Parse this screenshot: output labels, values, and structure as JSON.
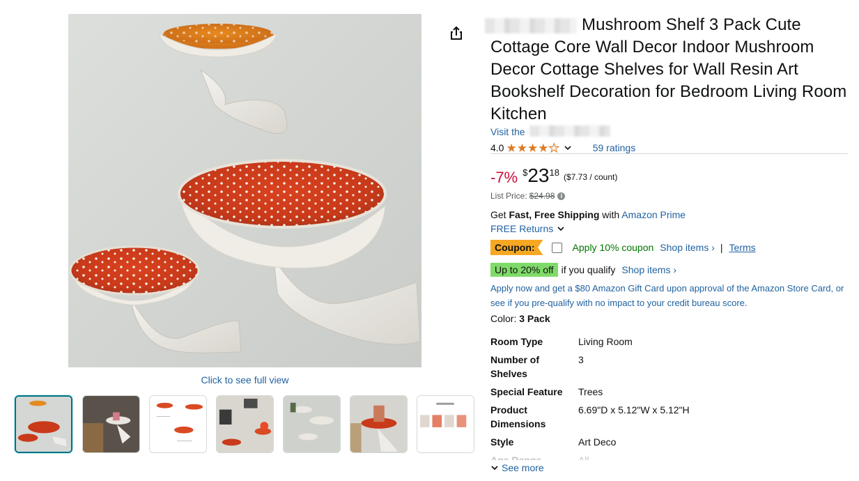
{
  "product": {
    "title": "Mushroom Shelf 3 Pack Cute Cottage Core Wall Decor Indoor Mushroom Decor Cottage Shelves for Wall Resin Art Bookshelf Decoration for Bedroom Living Room Kitchen",
    "store_link_prefix": "Visit the "
  },
  "rating": {
    "value": "4.0",
    "stars": 4,
    "count_label": "59 ratings"
  },
  "price": {
    "discount": "-7%",
    "currency": "$",
    "whole": "23",
    "fraction": "18",
    "unit_price": "($7.73 / count)",
    "list_label": "List Price:",
    "list_value": "$24.98"
  },
  "shipping": {
    "get": "Get ",
    "fast_free": "Fast, Free Shipping",
    "with": " with ",
    "prime_link": "Amazon Prime",
    "returns": "FREE Returns"
  },
  "coupon": {
    "badge": "Coupon:",
    "text": "Apply 10% coupon",
    "shop_items": "Shop items ›",
    "separator": "|",
    "terms": "Terms"
  },
  "deal": {
    "badge": "Up to 20% off",
    "qualify": "if you qualify",
    "shop_items": "Shop items ›"
  },
  "card_offer": "Apply now and get a $80 Amazon Gift Card upon approval of the Amazon Store Card, or see if you pre-qualify with no impact to your credit bureau score.",
  "color": {
    "label": "Color: ",
    "value": "3 Pack"
  },
  "specs": [
    {
      "key": "Room Type",
      "value": "Living Room"
    },
    {
      "key": "Number of Shelves",
      "value": "3"
    },
    {
      "key": "Special Feature",
      "value": "Trees"
    },
    {
      "key": "Product Dimensions",
      "value": "6.69\"D x 5.12\"W x 5.12\"H"
    },
    {
      "key": "Style",
      "value": "Art Deco"
    },
    {
      "key": "Age Range",
      "value": "All"
    }
  ],
  "see_more": "See more",
  "gallery": {
    "full_view": "Click to see full view",
    "thumbnail_count": 7,
    "selected_index": 0
  },
  "icons": {
    "share": "share-icon",
    "star": "star-icon",
    "chevron": "chevron-down-icon",
    "info": "info-icon"
  },
  "colors": {
    "link": "#2162a1",
    "star": "#de7921",
    "discount": "#cc0c39",
    "coupon_badge": "#f6a823",
    "deal_badge": "#7fda69",
    "coupon_text": "#007600"
  }
}
